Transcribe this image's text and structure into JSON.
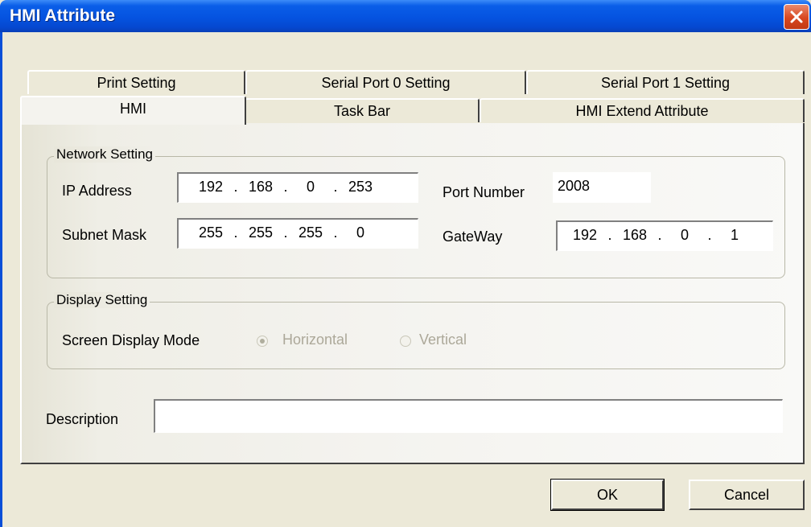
{
  "window": {
    "title": "HMI Attribute"
  },
  "tabs": {
    "row_back": [
      "Print Setting",
      "Serial Port 0 Setting",
      "Serial Port 1 Setting"
    ],
    "row_front": [
      "HMI",
      "Task Bar",
      "HMI Extend Attribute"
    ],
    "active": "HMI"
  },
  "network": {
    "legend": "Network Setting",
    "ip_label": "IP Address",
    "ip": [
      "192",
      "168",
      "0",
      "253"
    ],
    "subnet_label": "Subnet Mask",
    "subnet": [
      "255",
      "255",
      "255",
      "0"
    ],
    "port_label": "Port Number",
    "port": "2008",
    "gateway_label": "GateWay",
    "gateway": [
      "192",
      "168",
      "0",
      "1"
    ],
    "separator": "."
  },
  "display": {
    "legend": "Display Setting",
    "mode_label": "Screen Display Mode",
    "options": [
      {
        "label": "Horizontal",
        "selected": true
      },
      {
        "label": "Vertical",
        "selected": false
      }
    ]
  },
  "description": {
    "label": "Description",
    "value": ""
  },
  "buttons": {
    "ok": "OK",
    "cancel": "Cancel"
  }
}
